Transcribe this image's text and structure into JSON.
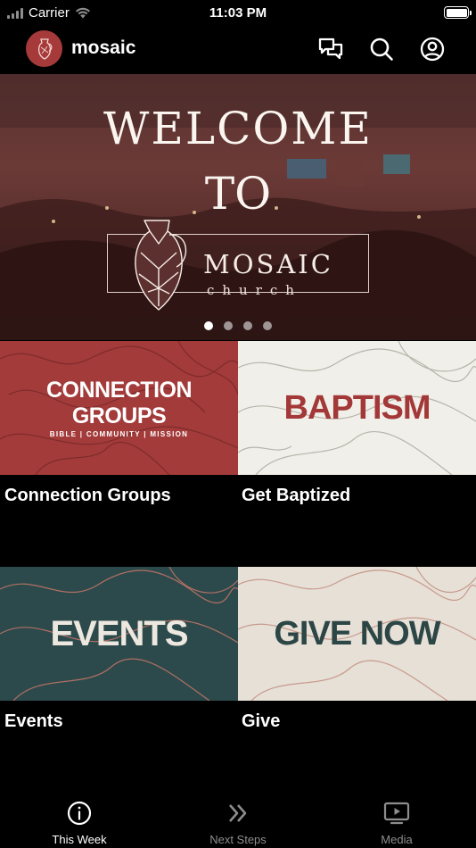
{
  "status_bar": {
    "carrier": "Carrier",
    "time": "11:03 PM"
  },
  "header": {
    "title": "mosaic"
  },
  "hero": {
    "line1": "WELCOME",
    "line2": "TO",
    "logo_word": "MOSAIC",
    "logo_sub": "church",
    "slide_count": 4,
    "active_slide": 1
  },
  "tiles": [
    {
      "image_title": "CONNECTION GROUPS",
      "image_subtitle": "BIBLE | COMMUNITY | MISSION",
      "caption": "Connection Groups"
    },
    {
      "image_title": "BAPTISM",
      "caption": "Get Baptized"
    },
    {
      "image_title": "EVENTS",
      "caption": "Events"
    },
    {
      "image_title": "GIVE NOW",
      "caption": "Give"
    }
  ],
  "colors": {
    "tile_red": "#a23b3a",
    "tile_cream": "#f1efe9",
    "tile_teal": "#2c4a4c",
    "tile_beige": "#e6e0d7",
    "active_tab": "#ffffff",
    "inactive_tab": "#8d8d8d"
  },
  "tab_bar": {
    "tabs": [
      {
        "label": "This Week",
        "icon": "info-icon",
        "active": true
      },
      {
        "label": "Next Steps",
        "icon": "double-chevron-icon",
        "active": false
      },
      {
        "label": "Media",
        "icon": "tv-play-icon",
        "active": false
      }
    ]
  }
}
